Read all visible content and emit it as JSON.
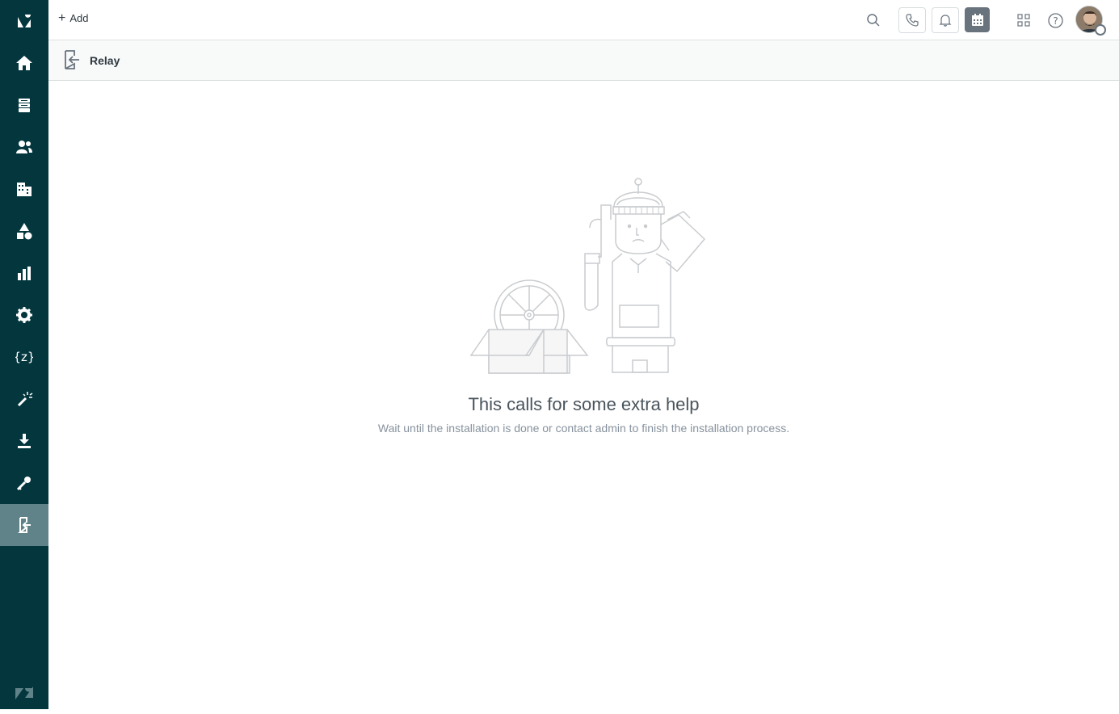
{
  "sidebar": {
    "items": [
      {
        "name": "logo",
        "icon": "zendesk-logo-icon"
      },
      {
        "name": "home",
        "icon": "home-icon"
      },
      {
        "name": "views",
        "icon": "views-icon"
      },
      {
        "name": "customers",
        "icon": "customers-icon"
      },
      {
        "name": "organizations",
        "icon": "organizations-icon"
      },
      {
        "name": "objects",
        "icon": "shapes-icon"
      },
      {
        "name": "reporting",
        "icon": "bar-chart-icon"
      },
      {
        "name": "admin",
        "icon": "gear-icon"
      },
      {
        "name": "code",
        "icon": "code-braces-icon"
      },
      {
        "name": "wand",
        "icon": "magic-wand-icon"
      },
      {
        "name": "download",
        "icon": "download-icon"
      },
      {
        "name": "keys",
        "icon": "key-icon"
      },
      {
        "name": "relay",
        "icon": "relay-icon",
        "active": true
      }
    ],
    "footer_icon": "zendesk-z-icon"
  },
  "topbar": {
    "add_label": "Add",
    "icons": [
      "search-icon",
      "phone-icon",
      "bell-icon",
      "calendar-icon",
      "apps-grid-icon",
      "help-icon"
    ]
  },
  "subheader": {
    "title": "Relay"
  },
  "empty_state": {
    "headline": "This calls for some extra help",
    "description": "Wait until the installation is done or contact admin to finish the installation process."
  },
  "colors": {
    "sidebar": "#03363d",
    "active": "#5f8388",
    "text": "#2f3941"
  }
}
